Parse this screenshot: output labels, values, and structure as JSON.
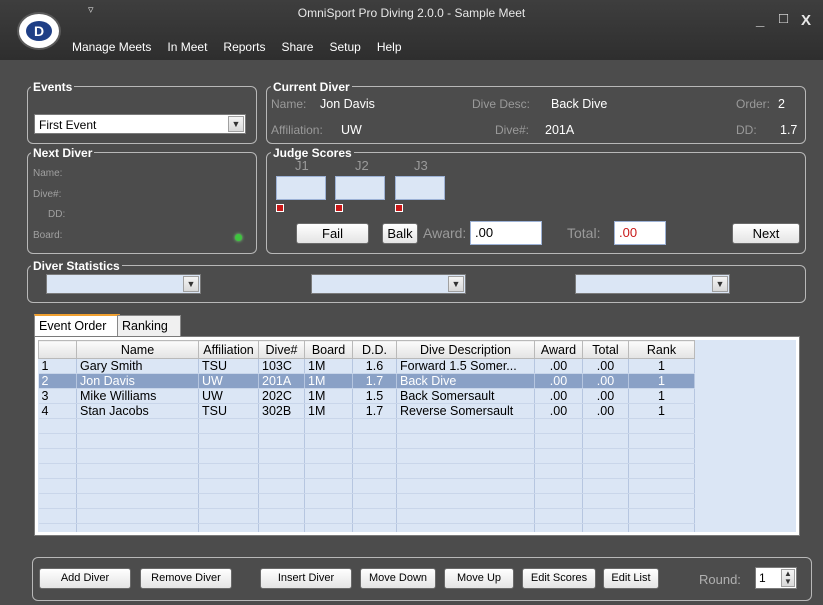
{
  "window": {
    "title": "OmniSport Pro Diving 2.0.0 - Sample Meet",
    "logo_letter": "D",
    "minimize": "_",
    "maximize": "□",
    "close": "X",
    "quick_access_arrow": "▿"
  },
  "menu": [
    "Manage Meets",
    "In Meet",
    "Reports",
    "Share",
    "Setup",
    "Help"
  ],
  "events": {
    "label": "Events",
    "selected": "First Event"
  },
  "current_diver": {
    "label": "Current Diver",
    "name_label": "Name:",
    "name": "Jon Davis",
    "affiliation_label": "Affiliation:",
    "affiliation": "UW",
    "dive_desc_label": "Dive Desc:",
    "dive_desc": "Back Dive",
    "dive_num_label": "Dive#:",
    "dive_num": "201A",
    "order_label": "Order:",
    "order": "2",
    "dd_label": "DD:",
    "dd": "1.7"
  },
  "next_diver": {
    "label": "Next Diver",
    "name_label": "Name:",
    "dive_label": "Dive#:",
    "dd_label": "DD:",
    "board_label": "Board:"
  },
  "judge_scores": {
    "label": "Judge Scores",
    "judges": [
      "J1",
      "J2",
      "J3"
    ],
    "fail_button": "Fail",
    "balk_button": "Balk",
    "award_label": "Award:",
    "award_value": ".00",
    "total_label": "Total:",
    "total_value": ".00",
    "next_button": "Next"
  },
  "diver_statistics": {
    "label": "Diver Statistics"
  },
  "tabs": [
    "Event Order",
    "Ranking"
  ],
  "table": {
    "headers": [
      "Name",
      "Affiliation",
      "Dive#",
      "Board",
      "D.D.",
      "Dive Description",
      "Award",
      "Total",
      "Rank"
    ],
    "rows": [
      {
        "idx": "1",
        "name": "Gary Smith",
        "aff": "TSU",
        "dive": "103C",
        "board": "1M",
        "dd": "1.6",
        "desc": "Forward 1.5 Somer...",
        "award": ".00",
        "total": ".00",
        "rank": "1"
      },
      {
        "idx": "2",
        "name": "Jon Davis",
        "aff": "UW",
        "dive": "201A",
        "board": "1M",
        "dd": "1.7",
        "desc": "Back Dive",
        "award": ".00",
        "total": ".00",
        "rank": "1"
      },
      {
        "idx": "3",
        "name": "Mike Williams",
        "aff": "UW",
        "dive": "202C",
        "board": "1M",
        "dd": "1.5",
        "desc": "Back Somersault",
        "award": ".00",
        "total": ".00",
        "rank": "1"
      },
      {
        "idx": "4",
        "name": "Stan Jacobs",
        "aff": "TSU",
        "dive": "302B",
        "board": "1M",
        "dd": "1.7",
        "desc": "Reverse Somersault",
        "award": ".00",
        "total": ".00",
        "rank": "1"
      }
    ],
    "selected_row": 1
  },
  "bottom": {
    "add_diver": "Add Diver",
    "remove_diver": "Remove Diver",
    "insert_diver": "Insert Diver",
    "move_down": "Move Down",
    "move_up": "Move Up",
    "edit_scores": "Edit Scores",
    "edit_list": "Edit List",
    "round_label": "Round:",
    "round_value": "1"
  },
  "colors": {
    "background": "#4c4c4c",
    "titlebar": "#333333",
    "selected_row": "#8aa1c6",
    "grid_bg": "#dbe6f5",
    "status_dot": "#3ec43e",
    "flag_red": "#c81818",
    "tab_accent": "#f0a030"
  }
}
